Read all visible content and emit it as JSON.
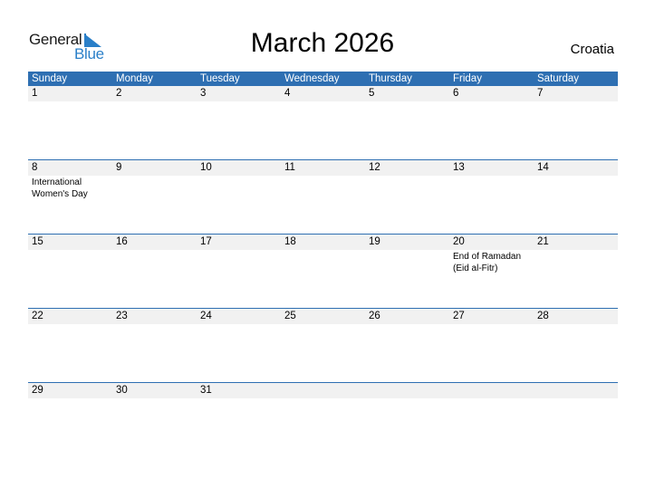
{
  "logo": {
    "word1": "General",
    "word2": "Blue",
    "icon": "triangle-flag-icon"
  },
  "title": "March 2026",
  "country": "Croatia",
  "colors": {
    "header_bg": "#2e6fb2",
    "band_bg": "#f1f1f1",
    "logo_blue": "#2a7fc8"
  },
  "days": [
    "Sunday",
    "Monday",
    "Tuesday",
    "Wednesday",
    "Thursday",
    "Friday",
    "Saturday"
  ],
  "weeks": [
    {
      "dates": [
        "1",
        "2",
        "3",
        "4",
        "5",
        "6",
        "7"
      ],
      "events": [
        "",
        "",
        "",
        "",
        "",
        "",
        ""
      ]
    },
    {
      "dates": [
        "8",
        "9",
        "10",
        "11",
        "12",
        "13",
        "14"
      ],
      "events": [
        "International Women's Day",
        "",
        "",
        "",
        "",
        "",
        ""
      ]
    },
    {
      "dates": [
        "15",
        "16",
        "17",
        "18",
        "19",
        "20",
        "21"
      ],
      "events": [
        "",
        "",
        "",
        "",
        "",
        "End of Ramadan (Eid al-Fitr)",
        ""
      ]
    },
    {
      "dates": [
        "22",
        "23",
        "24",
        "25",
        "26",
        "27",
        "28"
      ],
      "events": [
        "",
        "",
        "",
        "",
        "",
        "",
        ""
      ]
    },
    {
      "dates": [
        "29",
        "30",
        "31",
        "",
        "",
        "",
        ""
      ],
      "events": [
        "",
        "",
        "",
        "",
        "",
        "",
        ""
      ]
    }
  ]
}
